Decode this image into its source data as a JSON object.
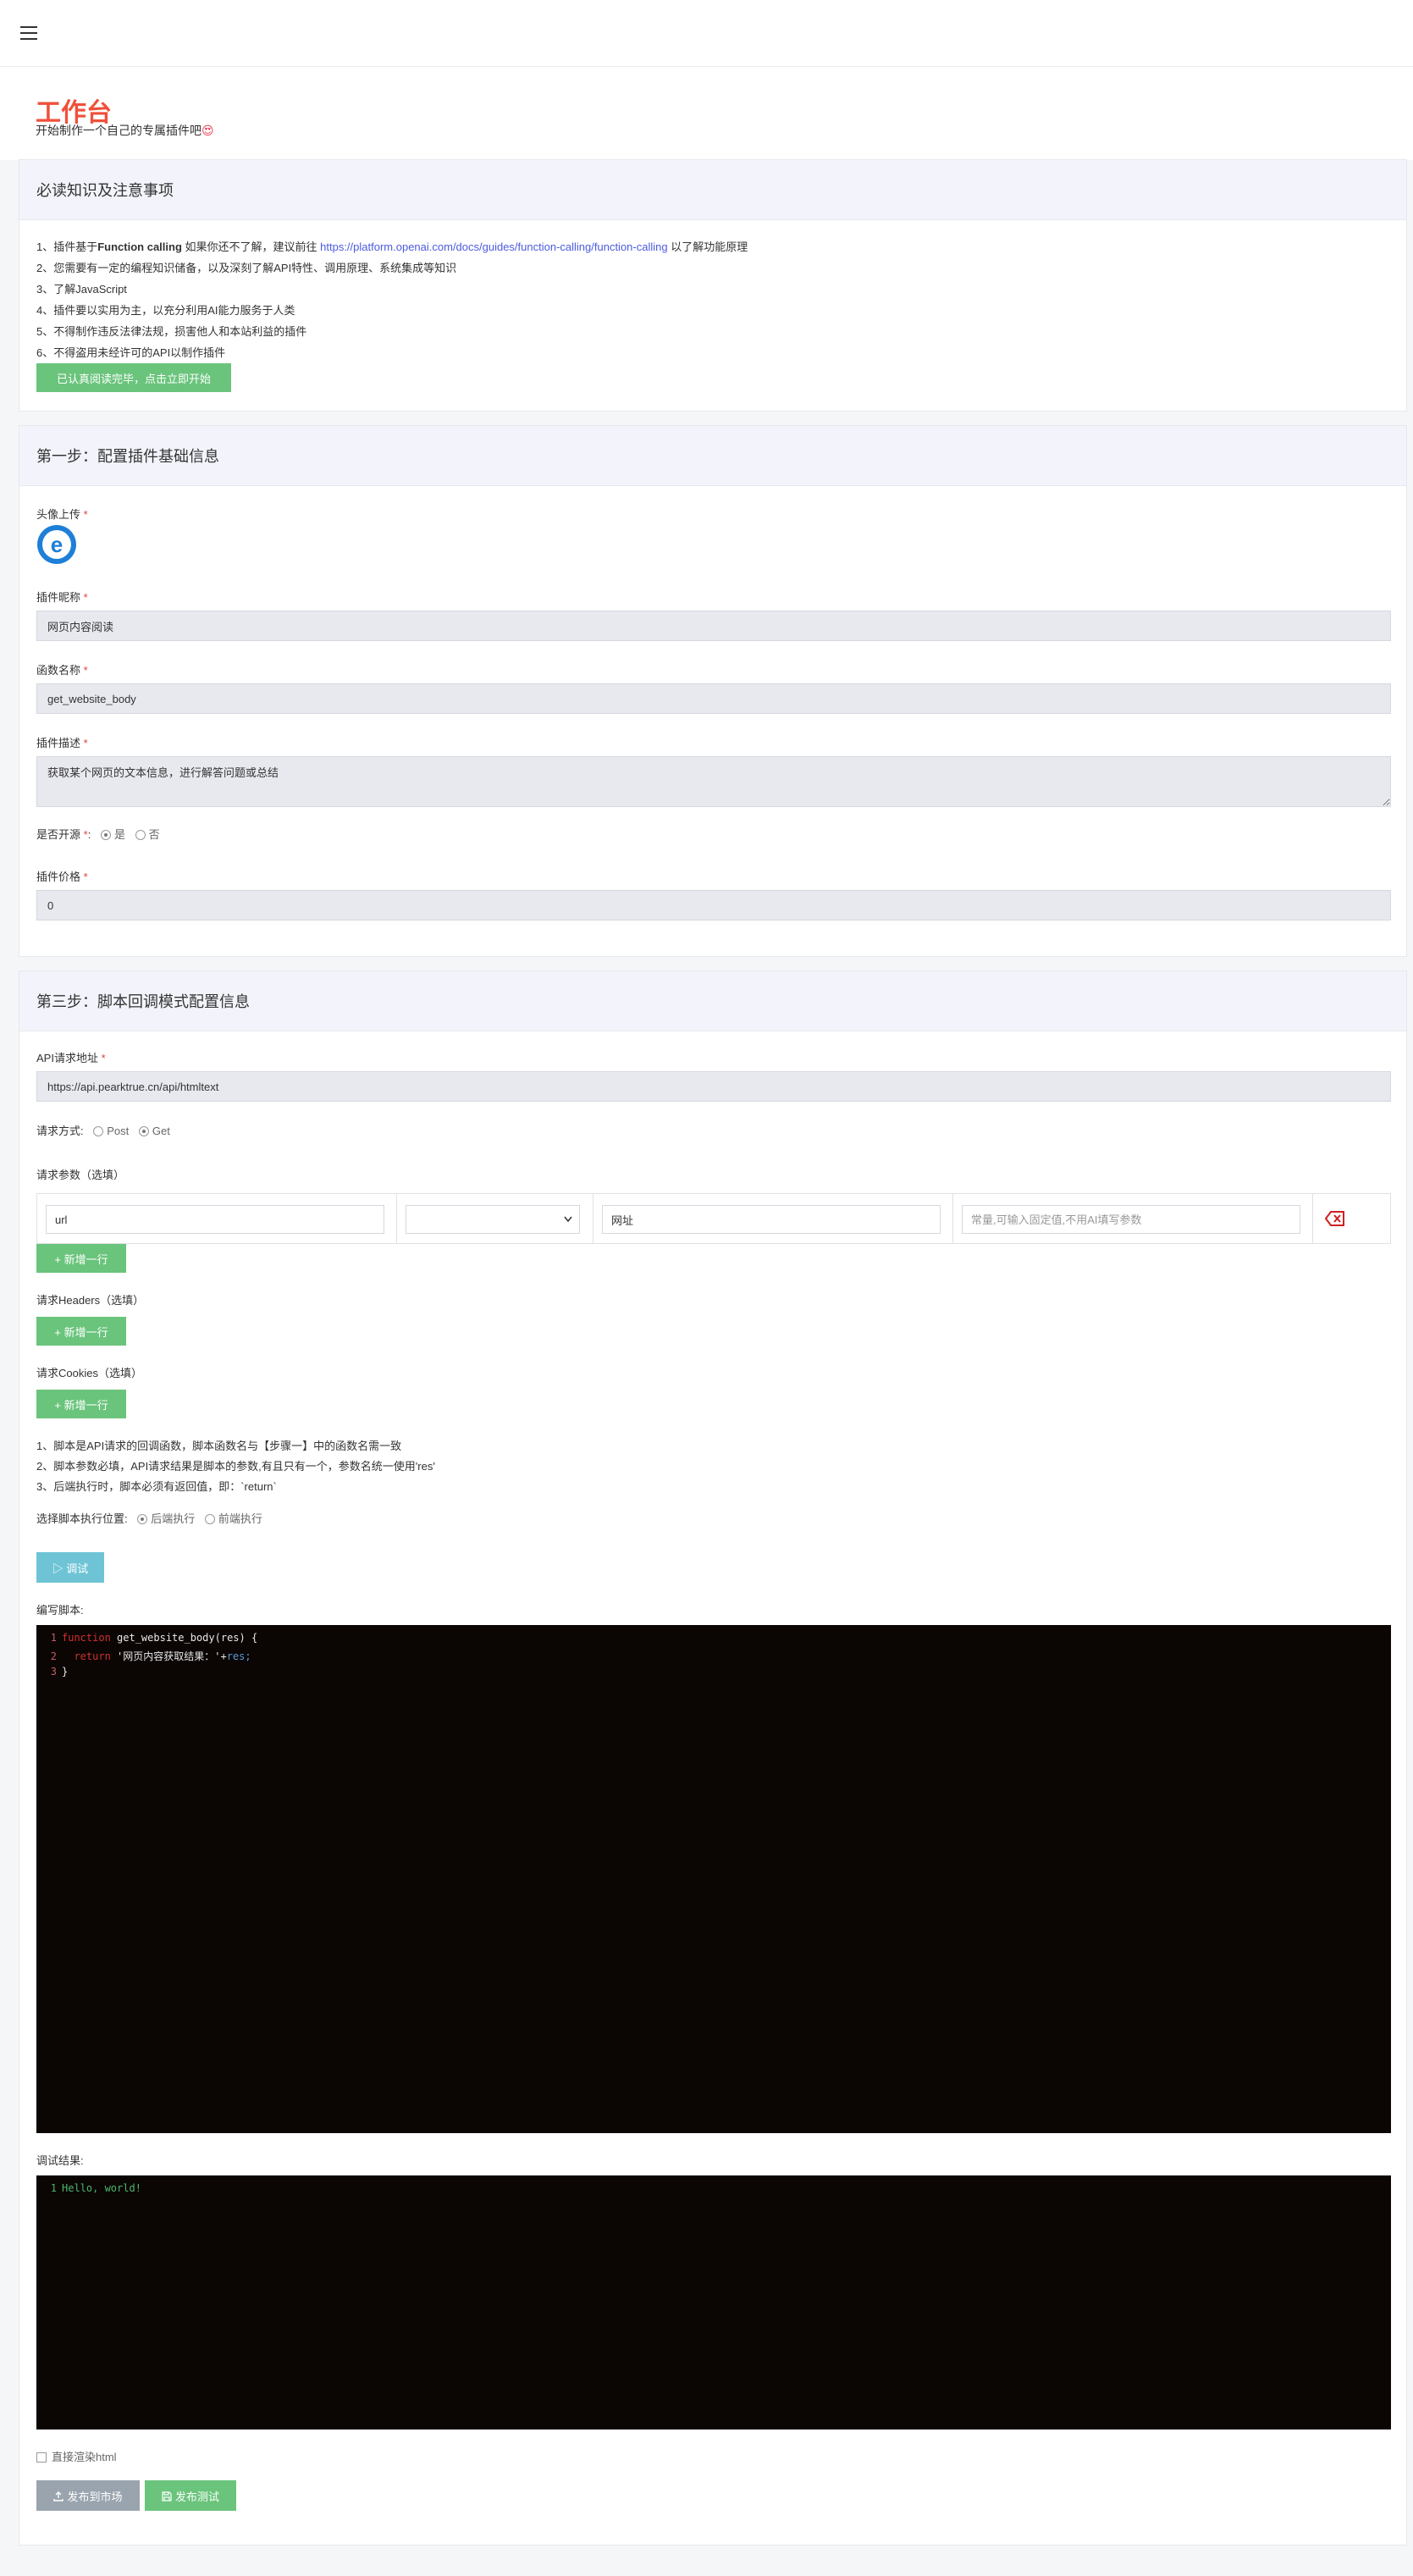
{
  "page": {
    "title": "工作台",
    "subtitle": "开始制作一个自己的专属插件吧",
    "subtitle_emoji": "😍"
  },
  "notice": {
    "title": "必读知识及注意事项",
    "items": [
      {
        "prefix": "1、插件基于",
        "bold": "Function calling",
        "text": " 如果你还不了解，建议前往 ",
        "link": "https://platform.openai.com/docs/guides/function-calling/function-calling",
        "suffix": " 以了解功能原理"
      },
      {
        "text": "2、您需要有一定的编程知识储备，以及深刻了解API特性、调用原理、系统集成等知识"
      },
      {
        "text": "3、了解JavaScript"
      },
      {
        "text": "4、插件要以实用为主，以充分利用AI能力服务于人类"
      },
      {
        "text": "5、不得制作违反法律法规，损害他人和本站利益的插件"
      },
      {
        "text": "6、不得盗用未经许可的API以制作插件"
      }
    ],
    "confirm_button": "已认真阅读完毕，点击立即开始"
  },
  "step1": {
    "title": "第一步：配置插件基础信息",
    "avatar_label": "头像上传",
    "name_label": "插件昵称",
    "name_value": "网页内容阅读",
    "func_label": "函数名称",
    "func_value": "get_website_body",
    "desc_label": "插件描述",
    "desc_value": "获取某个网页的文本信息，进行解答问题或总结",
    "opensource_label": "是否开源",
    "opensource_options": [
      "是",
      "否"
    ],
    "price_label": "插件价格",
    "price_value": "0",
    "required_mark": "*"
  },
  "step3": {
    "title": "第三步：脚本回调模式配置信息",
    "api_label": "API请求地址",
    "api_value": "https://api.pearktrue.cn/api/htmltext",
    "method_label": "请求方式:",
    "method_options": [
      "Post",
      "Get"
    ],
    "params_label": "请求参数（选填）",
    "param_row": {
      "name": "url",
      "type": "",
      "desc": "网址",
      "value_placeholder": "常量,可输入固定值,不用AI填写参数"
    },
    "add_row_label": "+ 新增一行",
    "headers_label": "请求Headers（选填）",
    "cookies_label": "请求Cookies（选填）",
    "script_notes": [
      "1、脚本是API请求的回调函数，脚本函数名与【步骤一】中的函数名需一致",
      "2、脚本参数必填，API请求结果是脚本的参数,有且只有一个，参数名统一使用'res'",
      "3、后端执行时，脚本必须有返回值，即：`return`"
    ],
    "exec_label": "选择脚本执行位置:",
    "exec_options": [
      "后端执行",
      "前端执行"
    ],
    "debug_button": "▷ 调试",
    "script_label": "编写脚本:",
    "code_lines": [
      {
        "n": "1",
        "kw": "function",
        "rest": " get_website_body(res) {"
      },
      {
        "n": "2",
        "kw": "  return",
        "str": " '网页内容获取结果：'+",
        "var": "res;"
      },
      {
        "n": "3",
        "rest": "}"
      }
    ],
    "result_label": "调试结果:",
    "result_lines": [
      {
        "n": "1",
        "text": "Hello, world!"
      }
    ],
    "render_html_label": "直接渲染html",
    "publish_market_button": "发布到市场",
    "publish_test_button": "发布测试"
  },
  "colors": {
    "accent": "#f0503a",
    "green": "#6ac47c",
    "cyan": "#6ec4d5",
    "link": "#4c5be0"
  }
}
